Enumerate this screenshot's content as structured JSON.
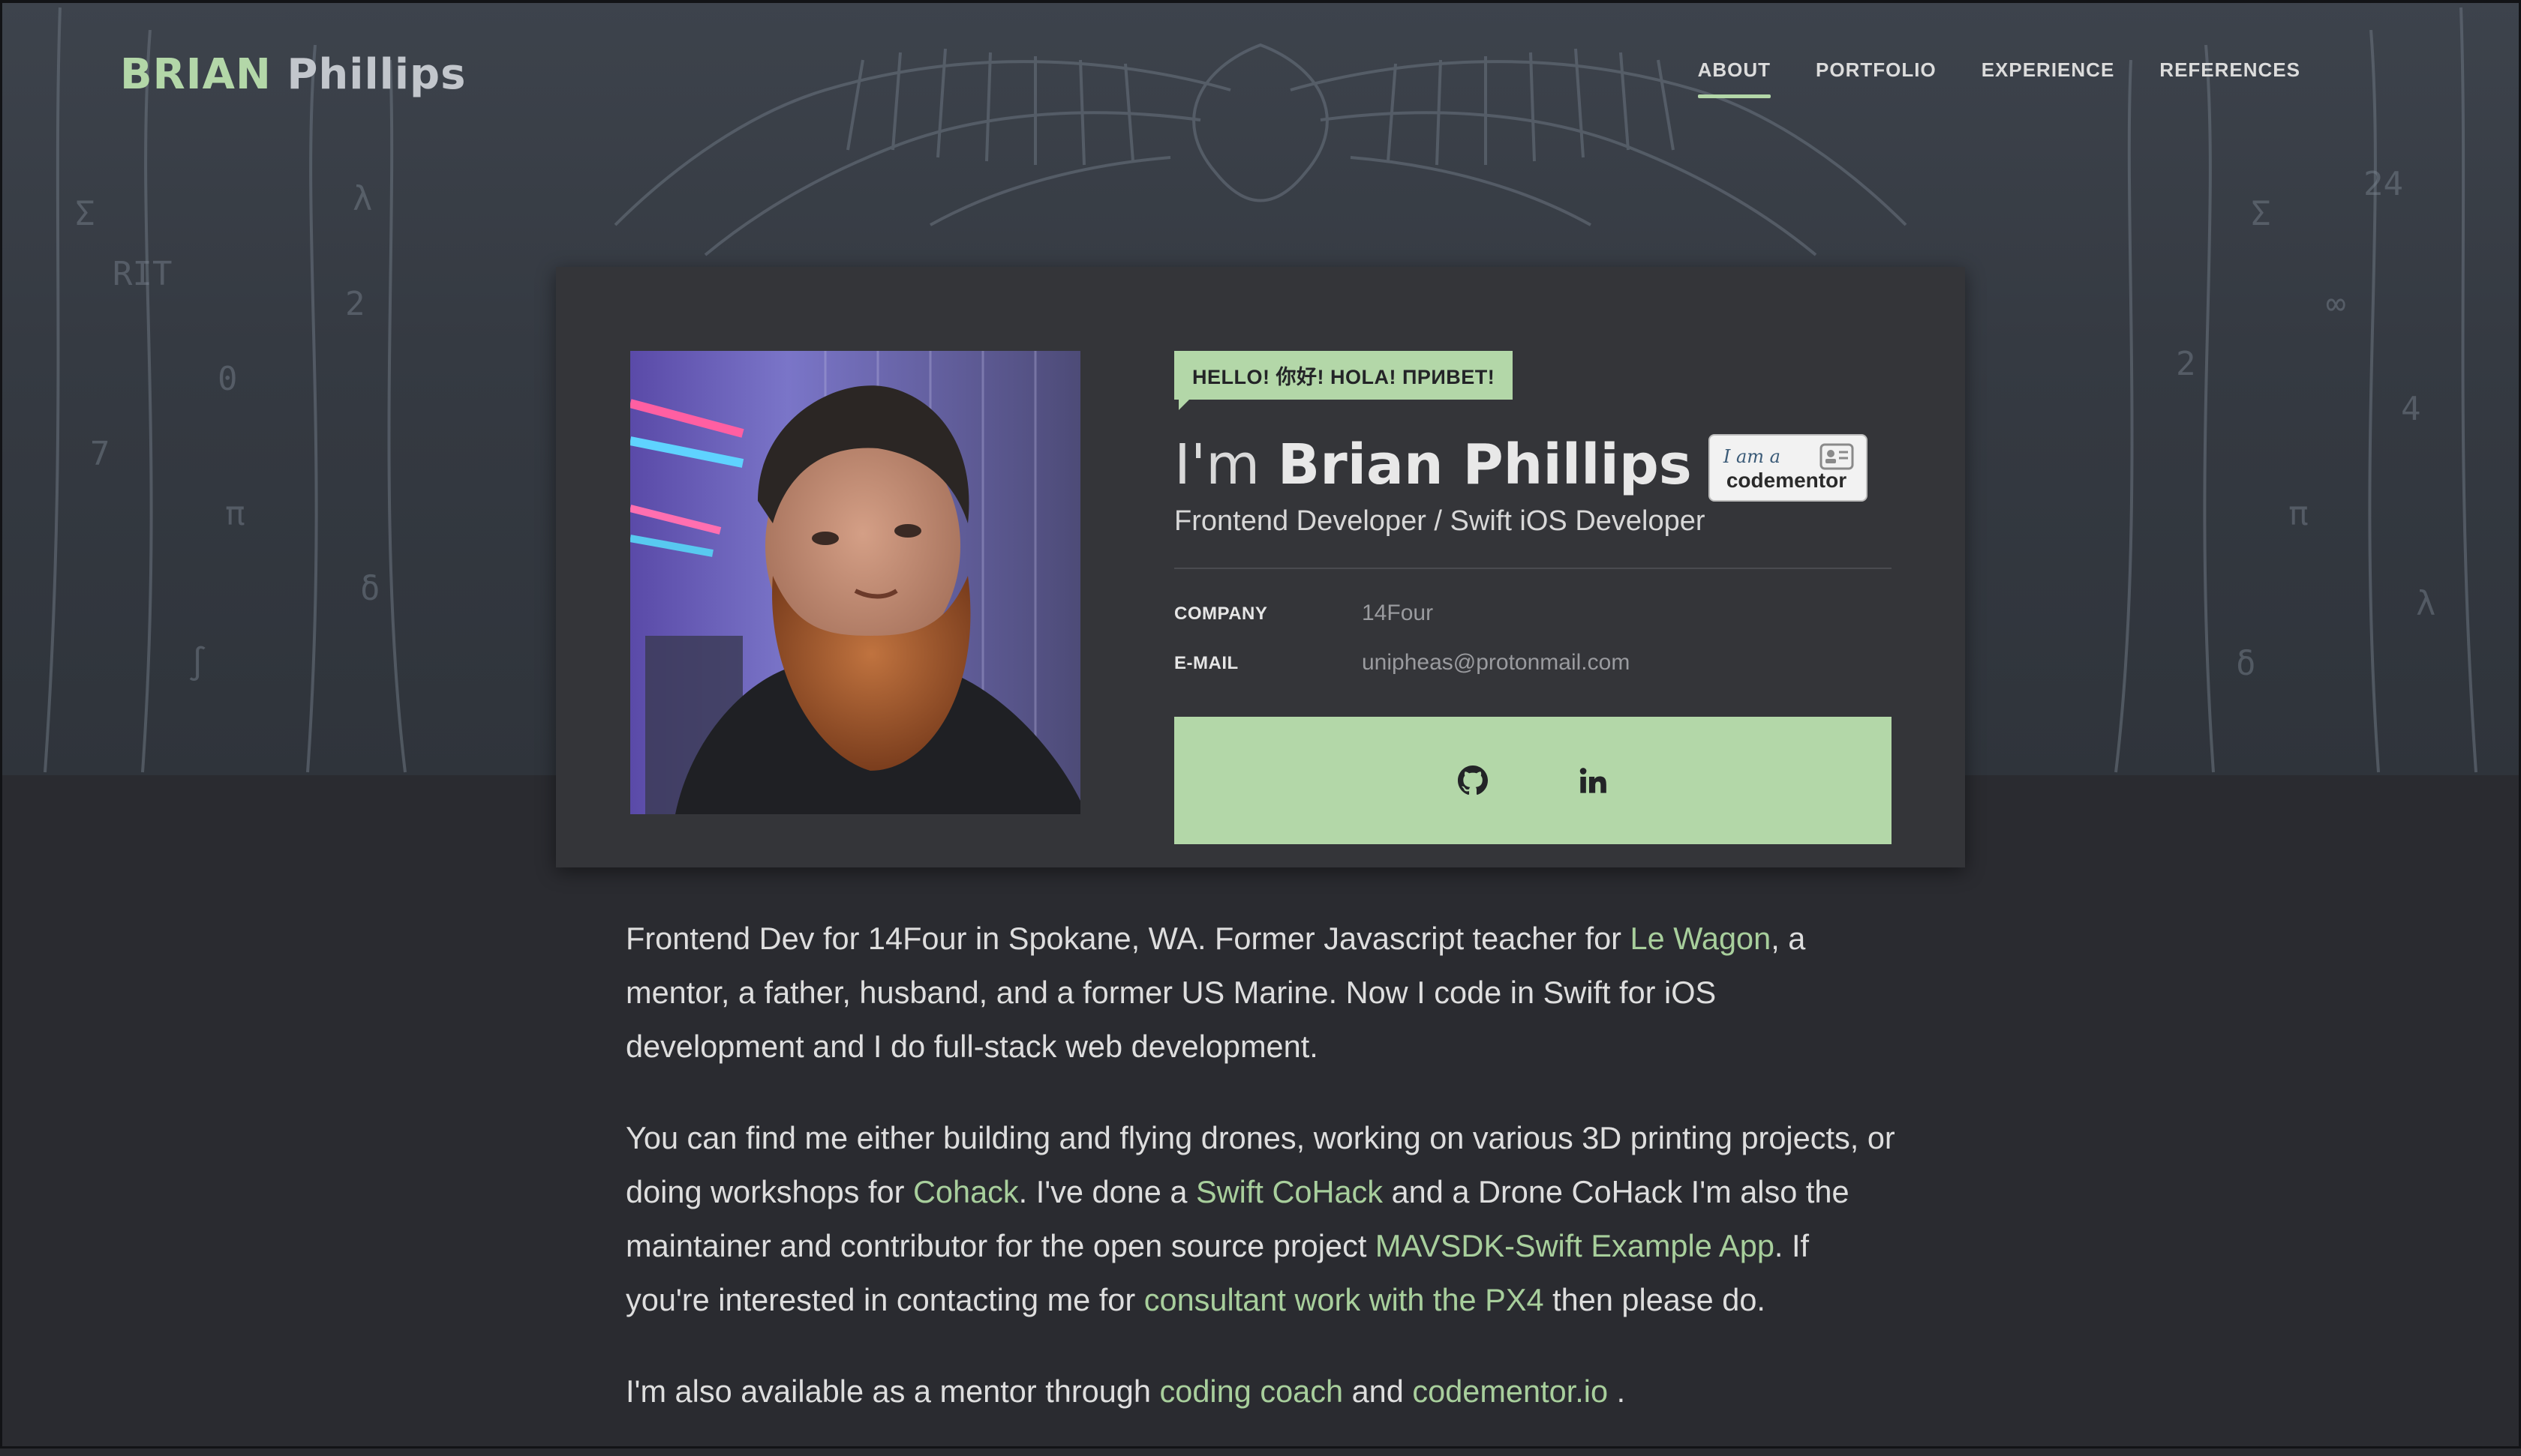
{
  "header": {
    "logo_first": "BRIAN",
    "logo_last": "Phillips",
    "nav": [
      {
        "label": "ABOUT",
        "active": true
      },
      {
        "label": "PORTFOLIO",
        "active": false
      },
      {
        "label": "EXPERIENCE",
        "active": false
      },
      {
        "label": "REFERENCES",
        "active": false
      }
    ]
  },
  "profile": {
    "greeting": "HELLO! 你好! HOLA! ПРИВЕТ!",
    "name_prefix": "I'm",
    "name": "Brian Phillips",
    "badge": {
      "line1": "I am a",
      "line2": "codementor"
    },
    "subtitle": "Frontend Developer / Swift iOS Developer",
    "company_label": "COMPANY",
    "company_value": "14Four",
    "email_label": "E-MAIL",
    "email_value": "unipheas@protonmail.com",
    "social": [
      {
        "name": "github-icon"
      },
      {
        "name": "linkedin-icon"
      }
    ]
  },
  "bio": {
    "p1": {
      "t1": "Frontend Dev for 14Four in Spokane, WA. Former Javascript teacher for ",
      "link1": "Le Wagon",
      "t2": ", a mentor, a father, husband, and a former US Marine. Now I code in Swift for iOS development and I do full-stack web development."
    },
    "p2": {
      "t1": "You can find me either building and flying drones, working on various 3D printing projects, or doing workshops for ",
      "link1": "Cohack",
      "t2": ". I've done a ",
      "link2": "Swift CoHack",
      "t3": " and a Drone CoHack I'm also the maintainer and contributor for the open source project ",
      "link3": "MAVSDK-Swift Example App",
      "t4": ". If you're interested in contacting me for ",
      "link4": "consultant work with the PX4",
      "t5": " then please do."
    },
    "p3": {
      "t1": "I'm also available as a mentor through ",
      "link1": "coding coach",
      "t2": " and ",
      "link2": "codementor.io",
      "t3": " ."
    }
  },
  "colors": {
    "accent": "#b3d7a8",
    "background": "#2a2b30",
    "card": "#343539",
    "link": "#a8cf9c"
  }
}
